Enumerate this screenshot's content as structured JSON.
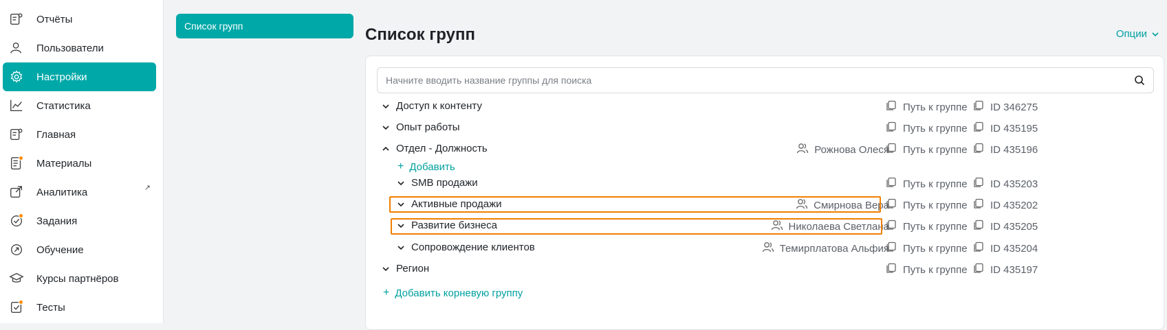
{
  "sidebar": {
    "items": [
      {
        "label": "Отчёты",
        "icon": "report-icon",
        "active": false
      },
      {
        "label": "Пользователи",
        "icon": "user-icon",
        "active": false
      },
      {
        "label": "Настройки",
        "icon": "gear-icon",
        "active": true
      },
      {
        "label": "Статистика",
        "icon": "chart-line-icon",
        "active": false
      },
      {
        "label": "Главная",
        "icon": "home-doc-icon",
        "active": false
      },
      {
        "label": "Материалы",
        "icon": "materials-icon",
        "active": false,
        "badge": true
      },
      {
        "label": "Аналитика",
        "icon": "external-link-icon",
        "active": false,
        "external": "↗"
      },
      {
        "label": "Задания",
        "icon": "task-check-icon",
        "active": false,
        "badge": true
      },
      {
        "label": "Обучение",
        "icon": "learning-icon",
        "active": false
      },
      {
        "label": "Курсы партнёров",
        "icon": "graduation-cap-icon",
        "active": false
      },
      {
        "label": "Тесты",
        "icon": "test-icon",
        "active": false,
        "badge": true
      }
    ]
  },
  "subpanel": {
    "item": "Список групп"
  },
  "header": {
    "title": "Список групп",
    "options": "Опции"
  },
  "search": {
    "placeholder": "Начните вводить название группы для поиска"
  },
  "groups": {
    "path_label": "Путь к группе",
    "rows": [
      {
        "name": "Доступ к контенту",
        "owner": "",
        "id": "ID 346275",
        "level": 0,
        "expanded": false
      },
      {
        "name": "Опыт работы",
        "owner": "",
        "id": "ID 435195",
        "level": 0,
        "expanded": false
      },
      {
        "name": "Отдел - Должность",
        "owner": "Рожнова Олеся",
        "id": "ID 435196",
        "level": 0,
        "expanded": true
      },
      {
        "name": "SMB продажи",
        "owner": "",
        "id": "ID 435203",
        "level": 1,
        "expanded": false
      },
      {
        "name": "Активные продажи",
        "owner": "Смирнова Вера",
        "id": "ID 435202",
        "level": 1,
        "expanded": false,
        "highlight": true
      },
      {
        "name": "Развитие бизнеса",
        "owner": "Николаева Светлана",
        "id": "ID 435205",
        "level": 1,
        "expanded": false,
        "highlight": true
      },
      {
        "name": "Сопровождение клиентов",
        "owner": "Темирплатова Альфия",
        "id": "ID 435204",
        "level": 1,
        "expanded": false
      },
      {
        "name": "Регион",
        "owner": "",
        "id": "ID 435197",
        "level": 0,
        "expanded": false
      }
    ],
    "add_child": "Добавить",
    "add_root": "Добавить корневую группу"
  },
  "colors": {
    "accent": "#00a8a8",
    "highlight": "#f07f00",
    "badge": "#ff8a00"
  }
}
